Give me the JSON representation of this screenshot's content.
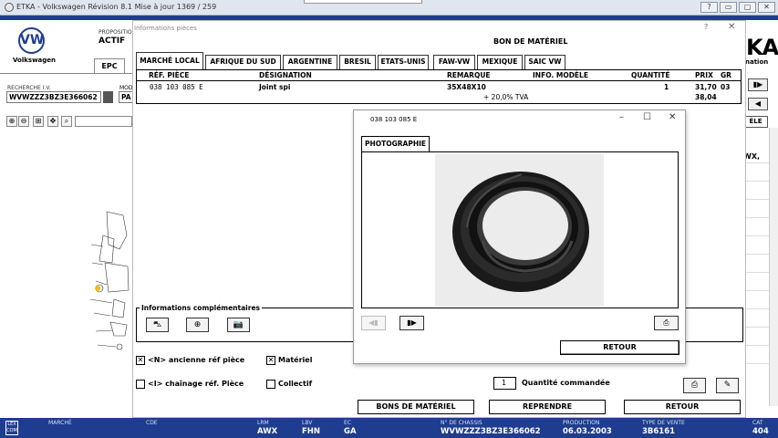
{
  "window": {
    "title": "ETKA - Volkswagen Révision 8.1 Mise à jour 1369 / 259"
  },
  "app": {
    "brand": "Volkswagen",
    "logo_text": "VW",
    "propositions_label": "PROPOSITIO",
    "actif_label": "ACTIF",
    "epc_tab": "EPC",
    "recherche_label": "RECHERCHE I.V.",
    "recherche_value": "WVWZZZ3BZ3E366062",
    "mod_label": "MOD",
    "mod_value": "PA",
    "right_big": "KA",
    "right_nation": "nation",
    "right_btn_label": "ÈLE",
    "right_wx": "WX,"
  },
  "dialog": {
    "title": "Informations pièces",
    "help": "?",
    "close": "✕",
    "header": "BON DE MATÉRIEL",
    "tabs": [
      "MARCHÉ LOCAL",
      "AFRIQUE DU SUD",
      "ARGENTINE",
      "BRESIL",
      "ETATS-UNIS",
      "FAW-VW",
      "MEXIQUE",
      "SAIC VW"
    ],
    "columns": {
      "ref": "RÉF. PIÈCE",
      "designation": "DÉSIGNATION",
      "remarque": "REMARQUE",
      "info": "INFO. MODÈLE",
      "quantite": "QUANTITÉ",
      "prix": "PRIX",
      "gr": "GR"
    },
    "row": {
      "ref": "038 103 085 E",
      "designation": "Joint spi",
      "remarque": "35X48X10",
      "quantite": "1",
      "prix": "31,70",
      "gr": "03"
    },
    "tva_label": "+ 20,0% TVA",
    "tva_prix": "38,04",
    "info_label": "Informations complémentaires",
    "ancienne_ref": "<N> ancienne réf pièce",
    "materiel": "Matériel",
    "chainage": "<I> chaînage réf. Pièce",
    "collectif": "Collectif",
    "quantite_value": "1",
    "quantite_label": "Quantité commandée",
    "buttons": {
      "bons": "BONS DE MATÉRIEL",
      "reprendre": "REPRENDRE",
      "retour": "RETOUR"
    }
  },
  "photo_dialog": {
    "title": "038 103 085 E",
    "tab": "PHOTOGRAPHIE",
    "retour": "RETOUR"
  },
  "status": {
    "marche_label": "MARCHÉ",
    "cde_label": "CDE",
    "lrm_label": "LRM",
    "lrm_value": "AWX",
    "lbv_label": "LBV",
    "lbv_value": "FHN",
    "ec_label": "EC",
    "ec_value": "GA",
    "chassis_label": "N° DE CHASSIS",
    "chassis_value": "WVWZZZ3BZ3E366062",
    "production_label": "PRODUCTION",
    "production_value": "06.03.2003",
    "vente_label": "TYPE DE VENTE",
    "vente_value": "3B6161",
    "cat_label": "CAT",
    "cat_value": "404",
    "logo": "LEX COM"
  },
  "colors": {
    "accent": "#1f3d8f",
    "seal": "#1a1a1a",
    "photo_bg": "#ececec"
  }
}
